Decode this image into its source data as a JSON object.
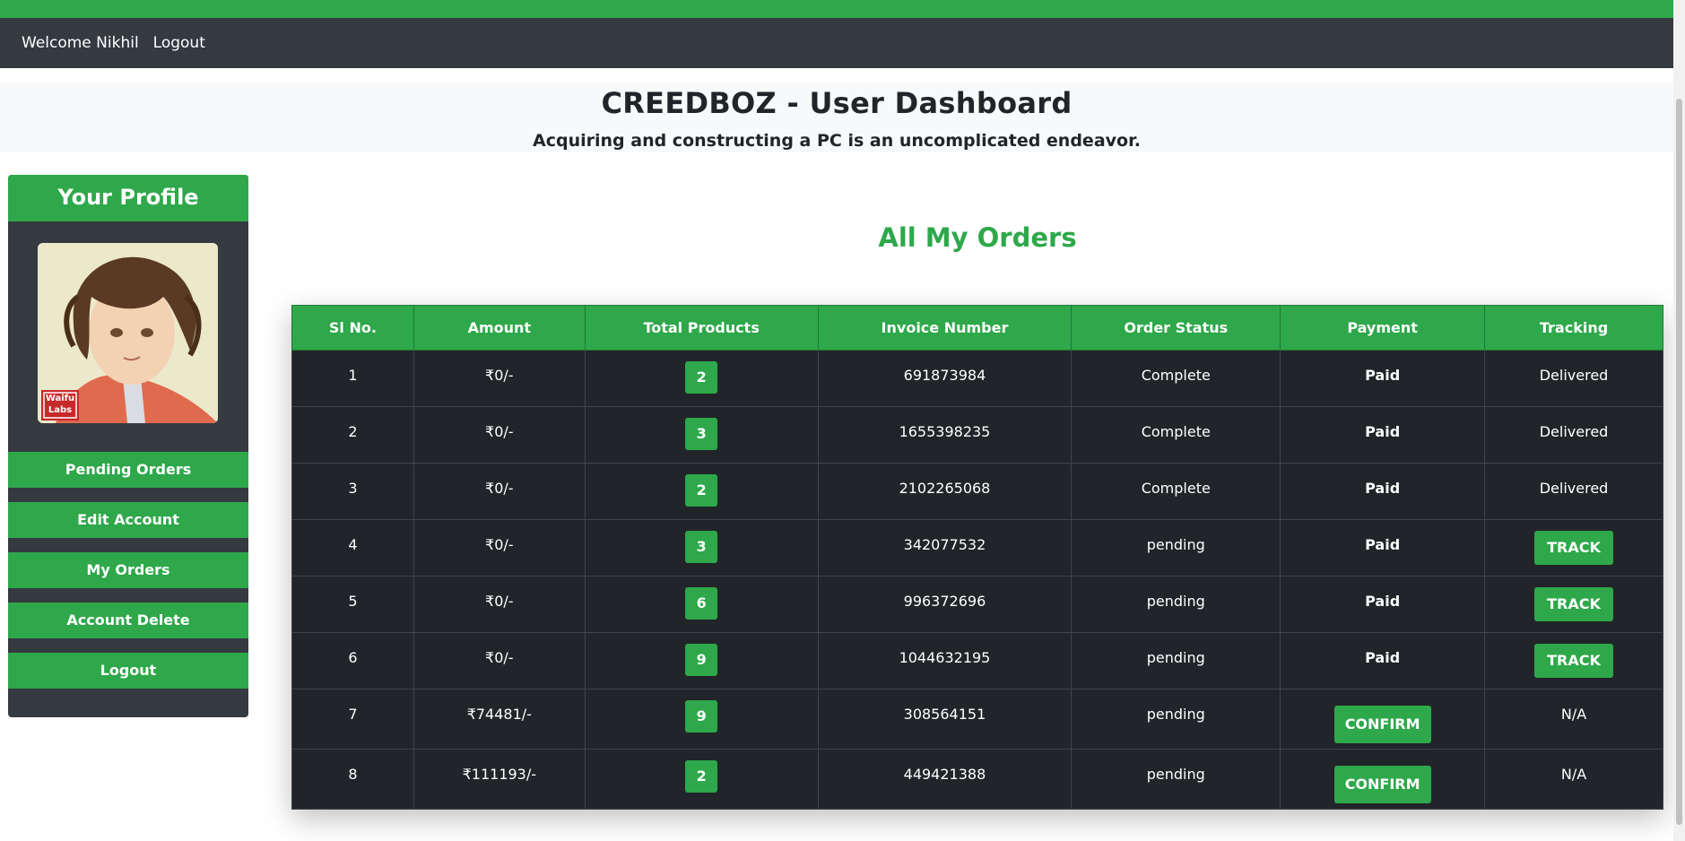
{
  "nav": {
    "welcome": "Welcome Nikhil",
    "logout": "Logout"
  },
  "hero": {
    "title": "CREEDBOZ - User Dashboard",
    "subtitle": "Acquiring and constructing a PC is an uncomplicated endeavor."
  },
  "sidebar": {
    "heading": "Your Profile",
    "avatar_badge": "Waifu Labs",
    "buttons": [
      "Pending Orders",
      "Edit Account",
      "My Orders",
      "Account Delete",
      "Logout"
    ]
  },
  "orders": {
    "title": "All My Orders",
    "columns": [
      "Sl No.",
      "Amount",
      "Total Products",
      "Invoice Number",
      "Order Status",
      "Payment",
      "Tracking"
    ],
    "rows": [
      {
        "sl": "1",
        "amount": "₹0/-",
        "products": "2",
        "invoice": "691873984",
        "status": "Complete",
        "payment": "Paid",
        "tracking": "Delivered"
      },
      {
        "sl": "2",
        "amount": "₹0/-",
        "products": "3",
        "invoice": "1655398235",
        "status": "Complete",
        "payment": "Paid",
        "tracking": "Delivered"
      },
      {
        "sl": "3",
        "amount": "₹0/-",
        "products": "2",
        "invoice": "2102265068",
        "status": "Complete",
        "payment": "Paid",
        "tracking": "Delivered"
      },
      {
        "sl": "4",
        "amount": "₹0/-",
        "products": "3",
        "invoice": "342077532",
        "status": "pending",
        "payment": "Paid",
        "tracking": "TRACK"
      },
      {
        "sl": "5",
        "amount": "₹0/-",
        "products": "6",
        "invoice": "996372696",
        "status": "pending",
        "payment": "Paid",
        "tracking": "TRACK"
      },
      {
        "sl": "6",
        "amount": "₹0/-",
        "products": "9",
        "invoice": "1044632195",
        "status": "pending",
        "payment": "Paid",
        "tracking": "TRACK"
      },
      {
        "sl": "7",
        "amount": "₹74481/-",
        "products": "9",
        "invoice": "308564151",
        "status": "pending",
        "payment": "CONFIRM",
        "tracking": "N/A"
      },
      {
        "sl": "8",
        "amount": "₹111193/-",
        "products": "2",
        "invoice": "449421388",
        "status": "pending",
        "payment": "CONFIRM",
        "tracking": "N/A"
      }
    ]
  },
  "colors": {
    "brand_green": "#2ea84a",
    "nav_dark": "#343a40",
    "table_dark": "#212529"
  }
}
